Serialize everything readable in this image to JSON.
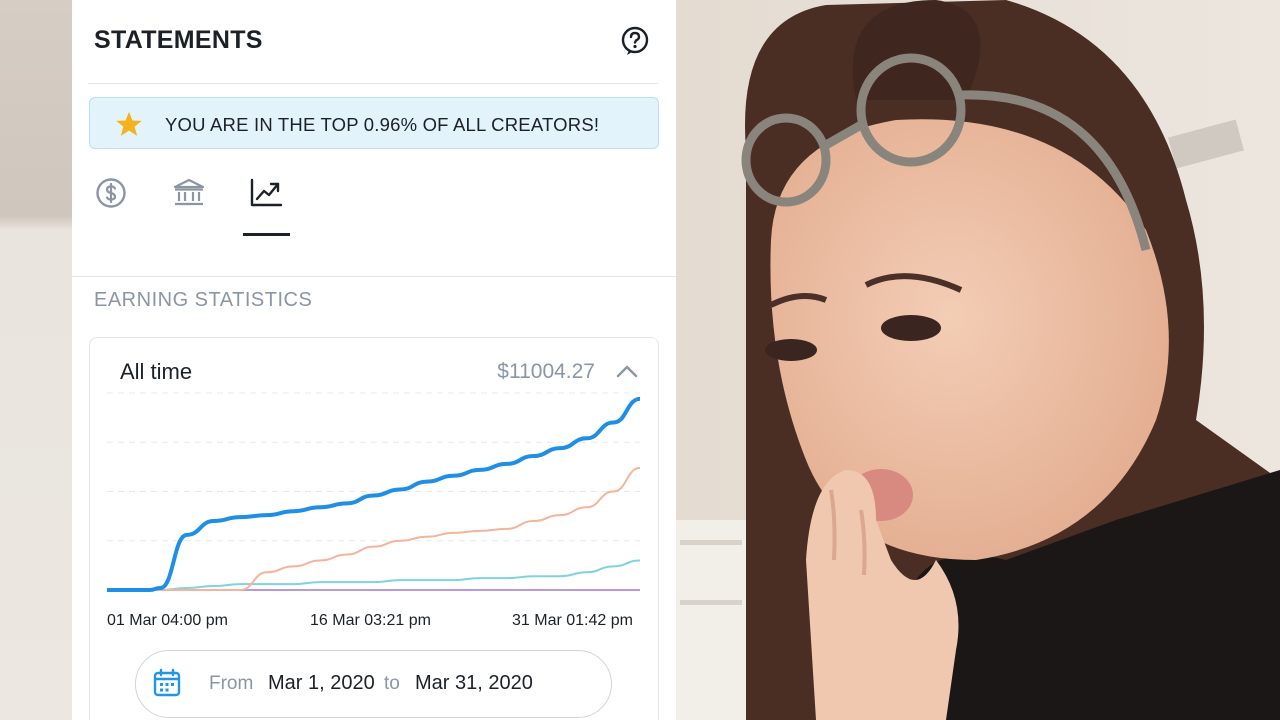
{
  "statements": {
    "title": "STATEMENTS",
    "banner_text": "YOU ARE IN THE TOP 0.96% OF ALL CREATORS!",
    "tabs": [
      {
        "icon": "dollar-circle-icon",
        "active": false
      },
      {
        "icon": "bank-icon",
        "active": false
      },
      {
        "icon": "trending-up-icon",
        "active": true
      }
    ]
  },
  "earnings": {
    "section_title": "EARNING STATISTICS",
    "period_label": "All time",
    "total": "$11004.27",
    "date_from_label": "From",
    "date_from": "Mar 1, 2020",
    "date_to_label": "to",
    "date_to": "Mar 31, 2020"
  },
  "colors": {
    "accent": "#2196e8",
    "banner_bg": "#e2f3fb",
    "star": "#f5b21f",
    "series_blue": "#1f8fe5",
    "series_orange": "#f5b49a",
    "series_cyan": "#7fd3e1",
    "series_purple": "#b99ad6"
  },
  "chart_data": {
    "type": "line",
    "x_tick_labels": [
      "01 Mar 04:00 pm",
      "16 Mar 03:21 pm",
      "31 Mar 01:42 pm"
    ],
    "x": [
      0,
      0.08,
      0.1,
      0.15,
      0.2,
      0.25,
      0.3,
      0.35,
      0.4,
      0.45,
      0.5,
      0.55,
      0.6,
      0.65,
      0.7,
      0.75,
      0.8,
      0.85,
      0.9,
      0.95,
      1.0
    ],
    "ylim": [
      0,
      100
    ],
    "grid": true,
    "series": [
      {
        "color": "#1f8fe5",
        "values": [
          0,
          0,
          1,
          28,
          35,
          37,
          38,
          40,
          42,
          44,
          48,
          51,
          55,
          58,
          61,
          64,
          68,
          72,
          77,
          85,
          97
        ]
      },
      {
        "color": "#f5b49a",
        "values": [
          0,
          0,
          0,
          0,
          0,
          0,
          9,
          12,
          15,
          18,
          22,
          25,
          27,
          29,
          30,
          31,
          35,
          38,
          42,
          50,
          62
        ]
      },
      {
        "color": "#7fd3e1",
        "values": [
          0,
          0,
          0,
          1,
          2,
          3,
          3,
          3,
          4,
          4,
          4,
          5,
          5,
          5,
          6,
          6,
          7,
          7,
          9,
          12,
          15
        ]
      },
      {
        "color": "#b99ad6",
        "values": [
          0,
          0,
          0,
          0,
          0,
          0,
          0,
          0,
          0,
          0,
          0,
          0,
          0,
          0,
          0,
          0,
          0,
          0,
          0,
          0,
          0
        ]
      }
    ]
  }
}
